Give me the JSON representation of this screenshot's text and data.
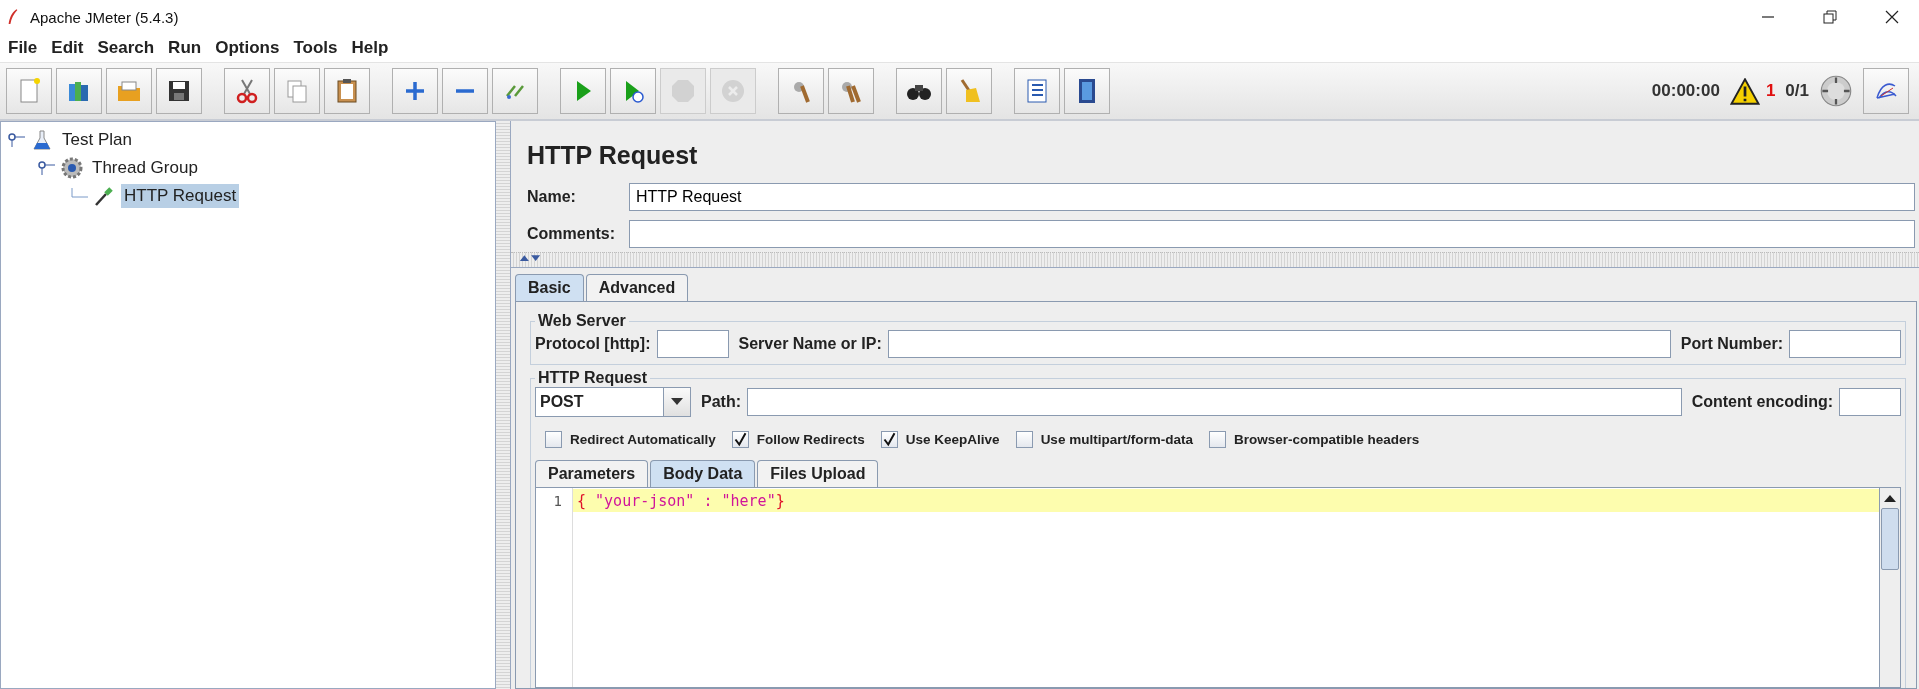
{
  "window": {
    "title": "Apache JMeter (5.4.3)"
  },
  "menu": [
    "File",
    "Edit",
    "Search",
    "Run",
    "Options",
    "Tools",
    "Help"
  ],
  "toolbar": [
    {
      "kind": "new",
      "disabled": false
    },
    {
      "kind": "templates",
      "disabled": false
    },
    {
      "kind": "open",
      "disabled": false
    },
    {
      "kind": "save",
      "disabled": false
    },
    {
      "kind": "sep"
    },
    {
      "kind": "cut",
      "disabled": false
    },
    {
      "kind": "copy",
      "disabled": false
    },
    {
      "kind": "paste",
      "disabled": false
    },
    {
      "kind": "sep"
    },
    {
      "kind": "expand",
      "disabled": false
    },
    {
      "kind": "collapse",
      "disabled": false
    },
    {
      "kind": "toggle",
      "disabled": false
    },
    {
      "kind": "sep"
    },
    {
      "kind": "start",
      "disabled": false
    },
    {
      "kind": "start-no-pause",
      "disabled": false
    },
    {
      "kind": "stop",
      "disabled": true
    },
    {
      "kind": "shutdown",
      "disabled": true
    },
    {
      "kind": "sep"
    },
    {
      "kind": "clear",
      "disabled": false
    },
    {
      "kind": "clear-all",
      "disabled": false
    },
    {
      "kind": "sep"
    },
    {
      "kind": "search",
      "disabled": false
    },
    {
      "kind": "reset",
      "disabled": false
    },
    {
      "kind": "sep"
    },
    {
      "kind": "functions",
      "disabled": false
    },
    {
      "kind": "help",
      "disabled": false
    }
  ],
  "status": {
    "elapsed": "00:00:00",
    "warnings": "1",
    "threads": "0/1"
  },
  "tree": [
    {
      "label": "Test Plan",
      "selected": false,
      "children": [
        {
          "label": "Thread Group",
          "selected": false,
          "children": [
            {
              "label": "HTTP Request",
              "selected": true
            }
          ]
        }
      ]
    }
  ],
  "panel": {
    "title": "HTTP Request",
    "name_label": "Name:",
    "name_value": "HTTP Request",
    "comments_label": "Comments:",
    "tabs": [
      {
        "label": "Basic",
        "selected": true
      },
      {
        "label": "Advanced",
        "selected": false
      }
    ],
    "web_server": {
      "legend": "Web Server",
      "protocol_label": "Protocol [http]:",
      "server_label": "Server Name or IP:",
      "port_label": "Port Number:"
    },
    "http_request": {
      "legend": "HTTP Request",
      "method": "POST",
      "path_label": "Path:",
      "encoding_label": "Content encoding:",
      "options": [
        {
          "label": "Redirect Automatically",
          "checked": false
        },
        {
          "label": "Follow Redirects",
          "checked": true
        },
        {
          "label": "Use KeepAlive",
          "checked": true
        },
        {
          "label": "Use multipart/form-data",
          "checked": false
        },
        {
          "label": "Browser-compatible headers",
          "checked": false
        }
      ],
      "tabs": [
        {
          "label": "Parameters",
          "selected": false
        },
        {
          "label": "Body Data",
          "selected": true
        },
        {
          "label": "Files Upload",
          "selected": false
        }
      ],
      "editor": {
        "line_number": "1",
        "tokens": [
          {
            "kind": "brace",
            "text": "{"
          },
          {
            "kind": "string",
            "text": " \"your-json\" : \"here\""
          },
          {
            "kind": "brace",
            "text": "}"
          }
        ]
      }
    }
  }
}
